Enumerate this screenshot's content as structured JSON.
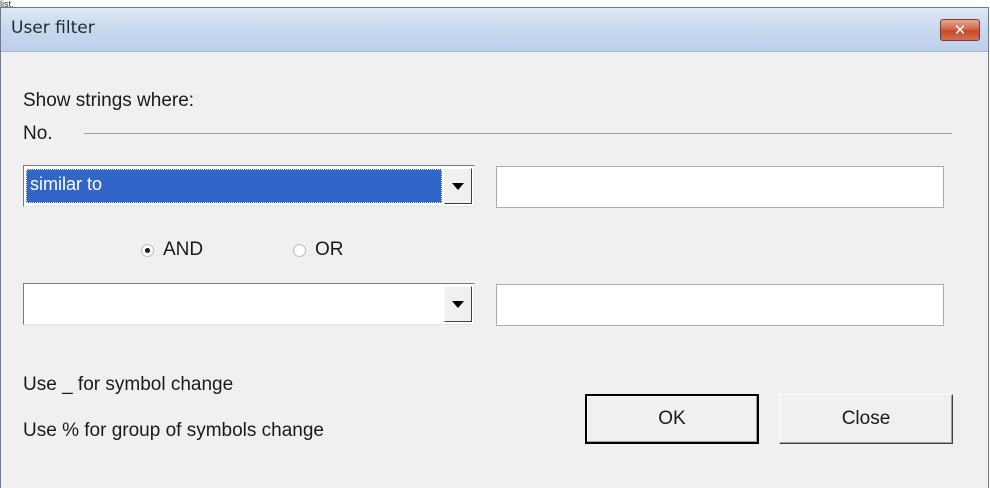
{
  "top_fragment": "list.",
  "window": {
    "title": "User filter",
    "close_glyph": "✕"
  },
  "content": {
    "header_label": "Show strings where:",
    "field_label": "No.",
    "condition1": {
      "operator": "similar to",
      "value": ""
    },
    "logic": {
      "and_label": "AND",
      "or_label": "OR",
      "selected": "AND"
    },
    "condition2": {
      "operator": "",
      "value": ""
    },
    "hint1": "Use _ for symbol change",
    "hint2": "Use % for group of symbols change"
  },
  "buttons": {
    "ok_label": "OK",
    "close_label": "Close"
  },
  "colors": {
    "titlebar": "#c9d9ee",
    "close_button": "#d4684a",
    "selection": "#3166c8",
    "dialog_bg": "#f0f0f0"
  },
  "icons": {
    "close": "close-icon",
    "dropdown": "chevron-down-icon",
    "radio_selected": "radio-selected-icon",
    "radio_unselected": "radio-unselected-icon"
  }
}
